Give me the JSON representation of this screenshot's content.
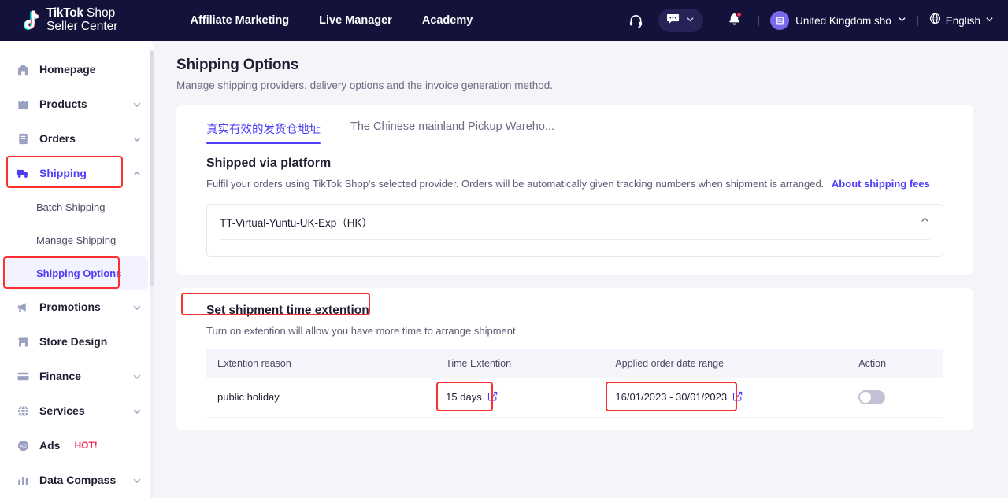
{
  "brand": {
    "logo_line1_bold": "TikTok",
    "logo_line1_rest": " Shop",
    "logo_line2": "Seller Center",
    "accent_purple": "#4e3df5",
    "nav_bg": "#13123b",
    "annotation_red": "#fc3030"
  },
  "topnav": {
    "links": [
      {
        "label": "Affiliate Marketing"
      },
      {
        "label": "Live Manager"
      },
      {
        "label": "Academy"
      }
    ],
    "support_icon": "headphones-icon",
    "chat_icon": "chat-bubble-icon",
    "chat_chevron_icon": "chevron-down-icon",
    "bell_icon": "bell-icon",
    "shop_avatar_icon": "shop-building-icon",
    "shop_name": "United Kingdom sho",
    "shop_chevron_icon": "chevron-down-icon",
    "globe_icon": "globe-icon",
    "language": "English",
    "language_chevron_icon": "chevron-down-icon"
  },
  "sidebar": {
    "items": [
      {
        "label": "Homepage",
        "icon": "home-icon",
        "expandable": false
      },
      {
        "label": "Products",
        "icon": "bag-icon",
        "expandable": true
      },
      {
        "label": "Orders",
        "icon": "clipboard-icon",
        "expandable": true
      },
      {
        "label": "Shipping",
        "icon": "truck-icon",
        "expandable": true,
        "active": true,
        "expanded": true
      },
      {
        "label": "Promotions",
        "icon": "megaphone-icon",
        "expandable": true
      },
      {
        "label": "Store Design",
        "icon": "storefront-icon",
        "expandable": false
      },
      {
        "label": "Finance",
        "icon": "card-icon",
        "expandable": true
      },
      {
        "label": "Services",
        "icon": "globe-icon",
        "expandable": true
      },
      {
        "label": "Ads",
        "icon": "ads-icon",
        "expandable": false,
        "badge": "HOT!"
      },
      {
        "label": "Data Compass",
        "icon": "bar-chart-icon",
        "expandable": true
      }
    ],
    "shipping_sub_items": [
      {
        "label": "Batch Shipping",
        "active": false
      },
      {
        "label": "Manage Shipping",
        "active": false
      },
      {
        "label": "Shipping Options",
        "active": true
      }
    ]
  },
  "main": {
    "page_title": "Shipping Options",
    "page_subtitle": "Manage shipping providers, delivery options and the invoice generation method.",
    "tabs": [
      {
        "label": "真实有效的发货仓地址",
        "active": true
      },
      {
        "label": "The Chinese mainland Pickup Wareho...",
        "active": false
      }
    ],
    "platform_section": {
      "title": "Shipped via platform",
      "description": "Fulfil your orders using TikTok Shop's selected provider. Orders will be automatically given tracking numbers when shipment is arranged.",
      "link_label": "About shipping fees",
      "provider_name": "TT-Virtual-Yuntu-UK-Exp（HK）",
      "provider_collapse_icon": "chevron-up-icon"
    },
    "extension_section": {
      "title": "Set shipment time extention",
      "description": "Turn on extention will allow you have more time to arrange shipment.",
      "table": {
        "columns": [
          "Extention reason",
          "Time Extention",
          "Applied order date range",
          "Action"
        ],
        "rows": [
          {
            "reason": "public holiday",
            "time_extension": "15 days",
            "time_extension_edit_icon": "edit-icon",
            "date_range": "16/01/2023 - 30/01/2023",
            "date_range_edit_icon": "edit-icon",
            "toggle_state": "off"
          }
        ]
      }
    }
  }
}
